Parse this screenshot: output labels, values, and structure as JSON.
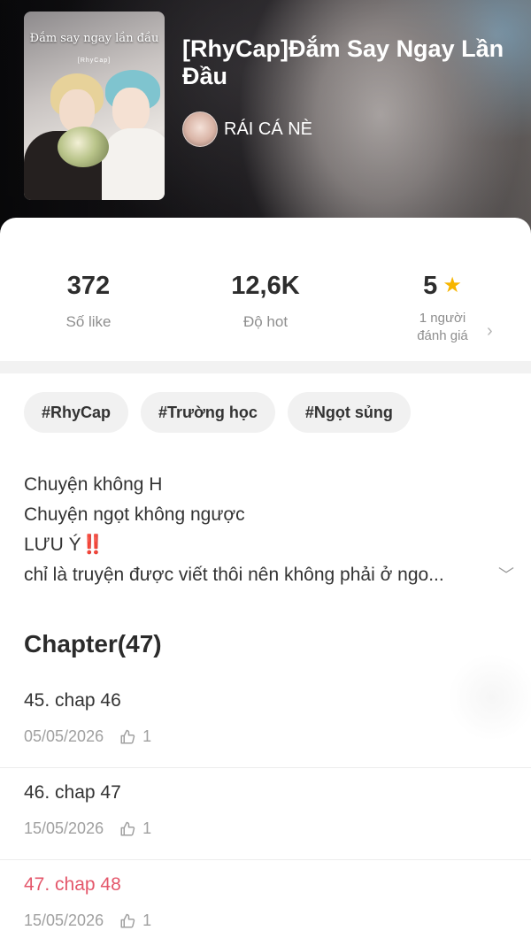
{
  "book": {
    "cover_title": "Đắm say ngay lần đầu",
    "cover_subtitle": "[RhyCap]",
    "title": "[RhyCap]Đắm Say Ngay Lần Đầu",
    "author": "RÁI CÁ NÈ"
  },
  "stats": {
    "likes": {
      "value": "372",
      "label": "Số like"
    },
    "hot": {
      "value": "12,6K",
      "label": "Độ hot"
    },
    "rating": {
      "value": "5",
      "label_line1": "1 người",
      "label_line2": "đánh giá"
    }
  },
  "tags": [
    "#RhyCap",
    "#Trường học",
    "#Ngọt sủng"
  ],
  "description": {
    "lines": [
      "Chuyện không H",
      "Chuyện ngọt không ngược",
      "LƯU Ý",
      "chỉ là truyện được viết thôi nên không phải ở ngo..."
    ],
    "warning_emoji": "‼️"
  },
  "chapters": {
    "header": "Chapter(47)",
    "items": [
      {
        "name": "45. chap 46",
        "date": "05/05/2026",
        "likes": "1"
      },
      {
        "name": "46. chap 47",
        "date": "15/05/2026",
        "likes": "1"
      },
      {
        "name": "47. chap 48",
        "date": "15/05/2026",
        "likes": "1",
        "current": true
      }
    ]
  },
  "colors": {
    "accent": "#e4576b",
    "star": "#f7b500",
    "tag_bg": "#f1f1f1"
  },
  "icons": {
    "rating": "star-icon",
    "expand": "chevron-down-icon",
    "ratings_link": "chevron-right-icon",
    "like": "thumbs-up-icon"
  }
}
